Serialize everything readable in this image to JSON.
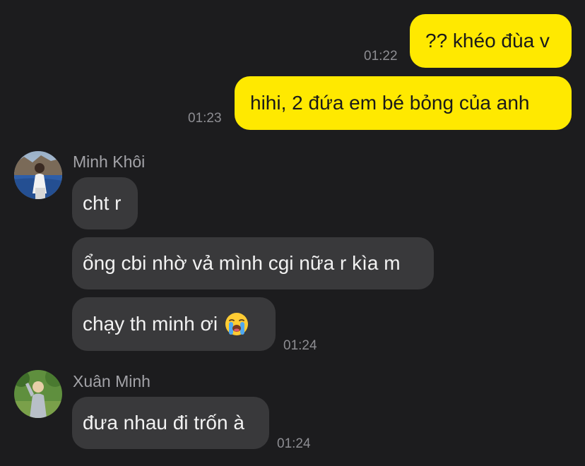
{
  "messages": {
    "m1": {
      "text": "?? khéo đùa v",
      "time": "01:22"
    },
    "m2": {
      "text": "hihi, 2 đứa em bé bỏng của anh",
      "time": "01:23"
    },
    "group1": {
      "sender": "Minh Khôi",
      "msg1": "cht r",
      "msg2": "ổng cbi nhờ vả mình cgi nữa r kìa m",
      "msg3": "chạy th minh ơi",
      "msg3_emoji": "loudly-crying-face",
      "time": "01:24"
    },
    "group2": {
      "sender": "Xuân Minh",
      "msg1": "đưa nhau đi trốn à",
      "time": "01:24"
    }
  },
  "colors": {
    "background": "#1c1c1e",
    "outgoing_bubble": "#ffe900",
    "incoming_bubble": "#39393b",
    "timestamp": "#8d8d92",
    "sender_name": "#a3a3a8"
  }
}
